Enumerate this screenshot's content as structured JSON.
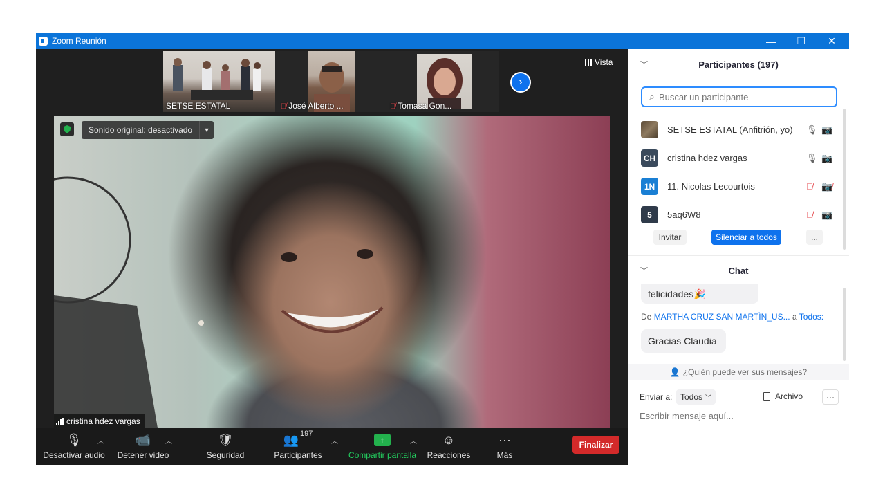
{
  "window": {
    "title": "Zoom Reunión",
    "minimize": "—",
    "restore": "❐",
    "close": "✕"
  },
  "thumbnails": [
    {
      "name": "SETSE ESTATAL",
      "muted": false
    },
    {
      "name": "José Alberto ...",
      "muted": true
    },
    {
      "name": "Tomasa Gon...",
      "muted": true
    }
  ],
  "view": {
    "label": "Vista"
  },
  "main_video": {
    "sound_original": "Sonido original: desactivado",
    "speaker_name": "cristina hdez vargas"
  },
  "toolbar": {
    "audio": "Desactivar audio",
    "video": "Detener video",
    "security": "Seguridad",
    "participants": "Participantes",
    "participants_count": "197",
    "share": "Compartir pantalla",
    "reactions": "Reacciones",
    "more": "Más",
    "end": "Finalizar"
  },
  "participants_panel": {
    "title": "Participantes (197)",
    "search_placeholder": "Buscar un participante",
    "list": [
      {
        "initials": "",
        "name": "SETSE ESTATAL (Anfitrión, yo)",
        "mic_muted": false,
        "video_off": false,
        "avatar_color": "#6b5a45"
      },
      {
        "initials": "CH",
        "name": "cristina hdez vargas",
        "mic_muted": false,
        "video_off": false,
        "avatar_color": "#3a4a5c"
      },
      {
        "initials": "1N",
        "name": "11. Nicolas Lecourtois",
        "mic_muted": true,
        "video_off": true,
        "avatar_color": "#1a7fd4"
      },
      {
        "initials": "5",
        "name": "5aq6W8",
        "mic_muted": true,
        "video_off": false,
        "avatar_color": "#2f3b4a"
      }
    ],
    "invite": "Invitar",
    "mute_all": "Silenciar a todos",
    "more": "..."
  },
  "chat": {
    "title": "Chat",
    "message1": "felicidades🎉",
    "from_prefix": "De",
    "from_user": "MARTHA CRUZ SAN MARTÌN_US...",
    "to_prefix": "a",
    "to_target": "Todos:",
    "message2": "Gracias Claudia",
    "who_can_see": "¿Quién puede ver sus mensajes?",
    "send_to_label": "Enviar a:",
    "send_to_value": "Todos",
    "file": "Archivo",
    "more": "···",
    "input_placeholder": "Escribir mensaje aquí..."
  }
}
